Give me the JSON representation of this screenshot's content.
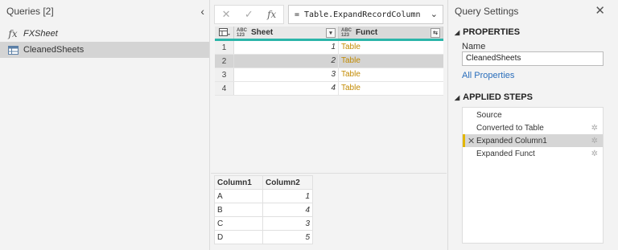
{
  "queries": {
    "header": "Queries [2]",
    "items": [
      {
        "icon": "fx-icon",
        "glyph": "fx",
        "label": "FXSheet"
      },
      {
        "icon": "table-icon",
        "label": "CleanedSheets"
      }
    ]
  },
  "formula_bar": {
    "cancel": "✕",
    "confirm": "✓",
    "fx": "fx",
    "formula": "= Table.ExpandRecordColumn"
  },
  "grid": {
    "type_badge_top": "ABC",
    "type_badge_bottom": "123",
    "columns": [
      "Sheet",
      "Funct"
    ],
    "rows": [
      {
        "n": "1",
        "sheet": "1",
        "funct": "Table"
      },
      {
        "n": "2",
        "sheet": "2",
        "funct": "Table"
      },
      {
        "n": "3",
        "sheet": "3",
        "funct": "Table"
      },
      {
        "n": "4",
        "sheet": "4",
        "funct": "Table"
      }
    ]
  },
  "preview": {
    "columns": [
      "Column1",
      "Column2"
    ],
    "rows": [
      [
        "A",
        "1"
      ],
      [
        "B",
        "4"
      ],
      [
        "C",
        "3"
      ],
      [
        "D",
        "5"
      ]
    ]
  },
  "settings": {
    "title": "Query Settings",
    "properties_header": "PROPERTIES",
    "name_label": "Name",
    "name_value": "CleanedSheets",
    "all_properties": "All Properties",
    "applied_steps_header": "APPLIED STEPS",
    "steps": [
      {
        "label": "Source",
        "gear": false
      },
      {
        "label": "Converted to Table",
        "gear": true
      },
      {
        "label": "Expanded Column1",
        "gear": true
      },
      {
        "label": "Expanded Funct",
        "gear": true
      }
    ]
  },
  "colors": {
    "accent_teal": "#2bb5a9",
    "table_text": "#c28a00",
    "selected_step_marker": "#e2b600",
    "link": "#2a6ebb"
  }
}
